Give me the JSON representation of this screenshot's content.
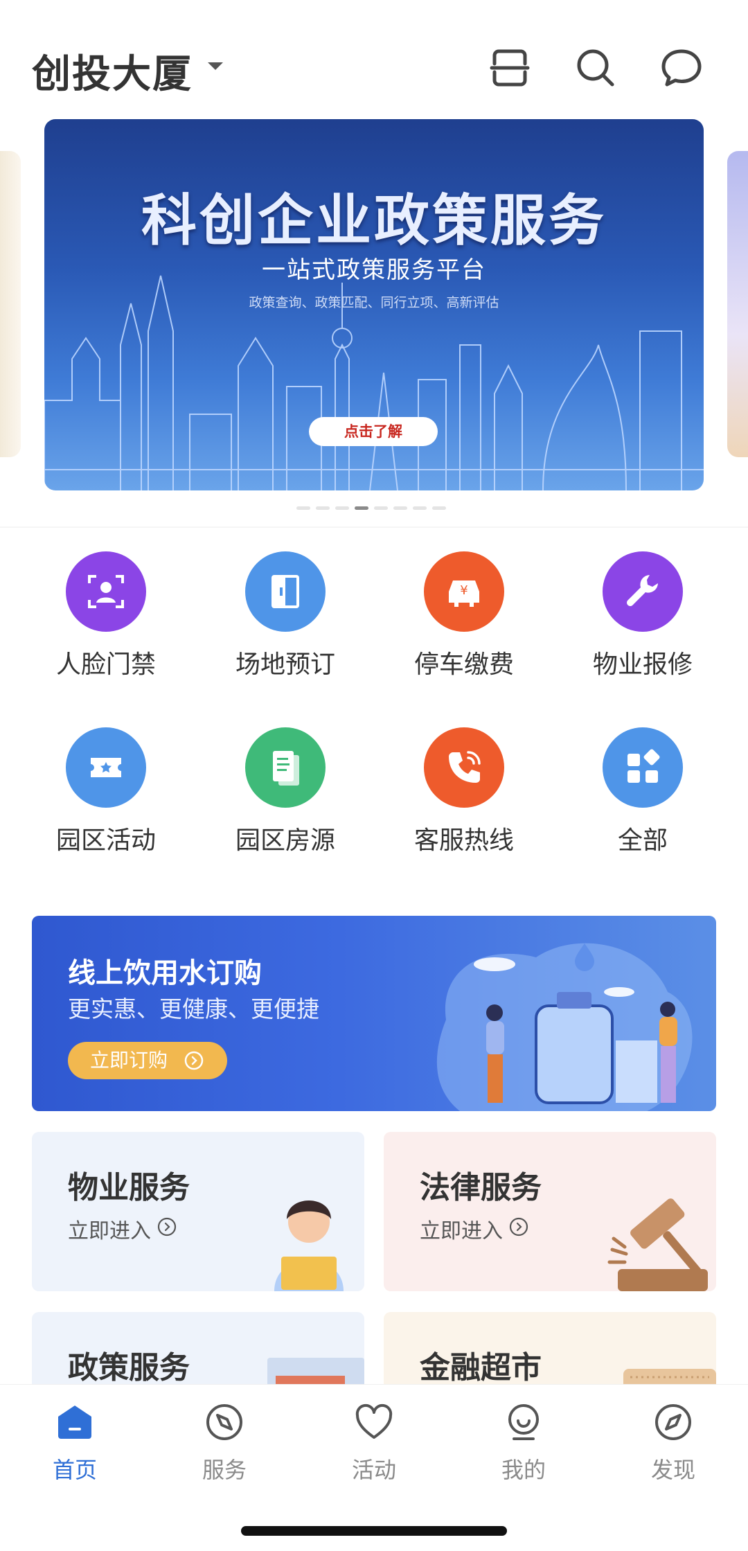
{
  "header": {
    "location": "创投大厦"
  },
  "banner": {
    "title": "科创企业政策服务",
    "subtitle": "一站式政策服务平台",
    "description": "政策查询、政策匹配、同行立项、高新评估",
    "button": "点击了解",
    "active_slide": 4,
    "slide_count": 8
  },
  "grid": {
    "items": [
      {
        "label": "人脸门禁",
        "icon": "face-id-icon",
        "color": "#8b45e6"
      },
      {
        "label": "场地预订",
        "icon": "door-icon",
        "color": "#4f95e8"
      },
      {
        "label": "停车缴费",
        "icon": "car-yen-icon",
        "color": "#ee5b2c"
      },
      {
        "label": "物业报修",
        "icon": "wrench-icon",
        "color": "#8b45e6"
      },
      {
        "label": "园区活动",
        "icon": "ticket-icon",
        "color": "#4f95e8"
      },
      {
        "label": "园区房源",
        "icon": "document-icon",
        "color": "#3fba79"
      },
      {
        "label": "客服热线",
        "icon": "phone-icon",
        "color": "#ee5b2c"
      },
      {
        "label": "全部",
        "icon": "apps-icon",
        "color": "#4f95e8"
      }
    ]
  },
  "water_banner": {
    "title": "线上饮用水订购",
    "subtitle": "更实惠、更健康、更便捷",
    "button": "立即订购"
  },
  "cards": [
    {
      "title": "物业服务",
      "link": "立即进入",
      "bg": "#eef3fb"
    },
    {
      "title": "法律服务",
      "link": "立即进入",
      "bg": "#fbeeed"
    },
    {
      "title": "政策服务",
      "bg": "#eef3fb"
    },
    {
      "title": "金融超市",
      "bg": "#fbf4ea"
    }
  ],
  "tabbar": {
    "items": [
      {
        "label": "首页",
        "icon": "home-icon",
        "active": true
      },
      {
        "label": "服务",
        "icon": "compass-icon",
        "active": false
      },
      {
        "label": "活动",
        "icon": "heart-icon",
        "active": false
      },
      {
        "label": "我的",
        "icon": "profile-icon",
        "active": false
      },
      {
        "label": "发现",
        "icon": "discover-icon",
        "active": false
      }
    ]
  },
  "colors": {
    "accent": "#2f6fd6",
    "inactive": "#8a8a8a"
  }
}
